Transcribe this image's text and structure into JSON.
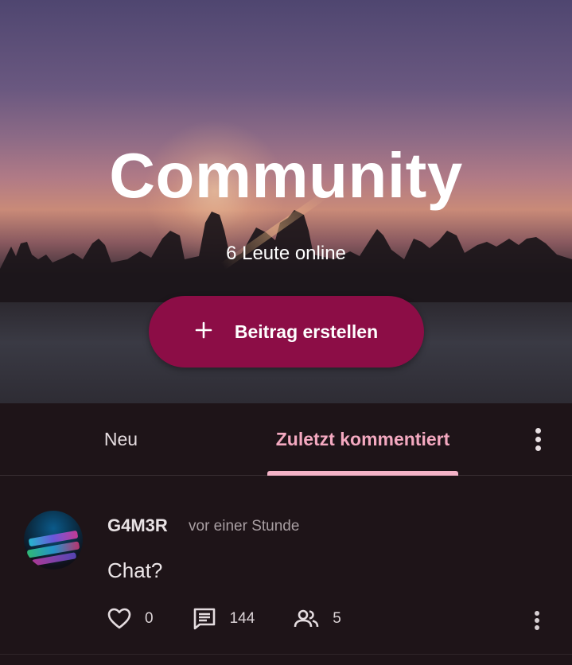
{
  "hero": {
    "title": "Community",
    "online_text": "6 Leute online",
    "create_button_label": "Beitrag erstellen"
  },
  "tabs": [
    {
      "label": "Neu",
      "active": false
    },
    {
      "label": "Zuletzt kommentiert",
      "active": true
    }
  ],
  "post": {
    "author": "G4M3R",
    "time": "vor einer Stunde",
    "text": "Chat?",
    "likes": "0",
    "comments": "144",
    "participants": "5"
  },
  "colors": {
    "accent_button": "#8c0d46",
    "active_tab": "#f4a9c0",
    "background": "#1e1418"
  },
  "icons": [
    "plus-icon",
    "more-vert-icon",
    "heart-outline-icon",
    "comment-icon",
    "people-icon"
  ]
}
